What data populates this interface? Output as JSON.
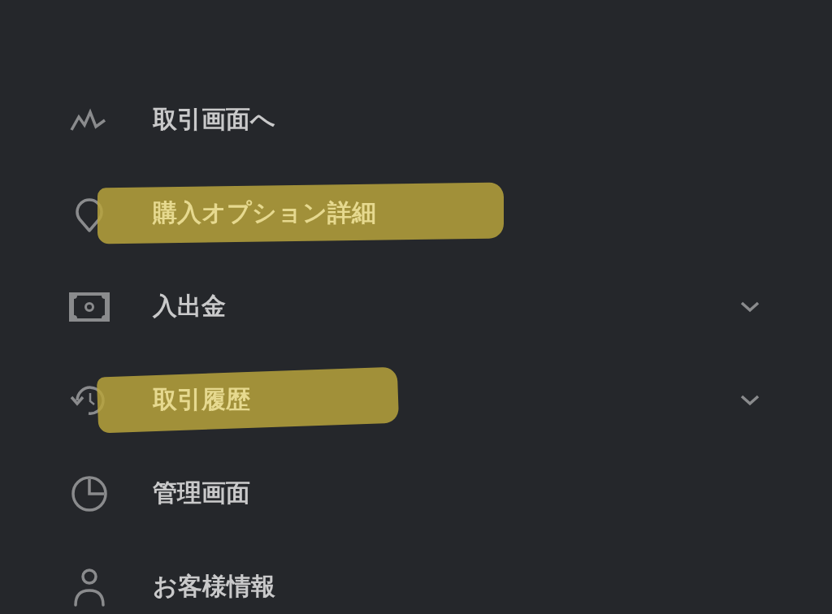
{
  "menu": [
    {
      "label": "取引画面へ",
      "expandable": false,
      "highlighted": false
    },
    {
      "label": "購入オプション詳細",
      "expandable": false,
      "highlighted": true
    },
    {
      "label": "入出金",
      "expandable": true,
      "highlighted": false
    },
    {
      "label": "取引履歴",
      "expandable": true,
      "highlighted": true
    },
    {
      "label": "管理画面",
      "expandable": false,
      "highlighted": false
    },
    {
      "label": "お客様情報",
      "expandable": false,
      "highlighted": false
    }
  ]
}
